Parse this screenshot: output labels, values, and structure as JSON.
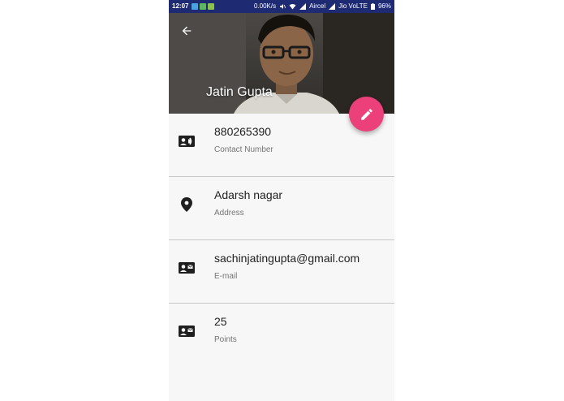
{
  "status_bar": {
    "time": "12:07",
    "speed": "0.00K/s",
    "carrier1": "Aircel",
    "carrier2": "Jio VoLTE",
    "battery": "96%"
  },
  "profile": {
    "name": "Jatin Gupta"
  },
  "colors": {
    "status_bar": "#1e2b73",
    "fab": "#ec407a",
    "background": "#f7f7f7"
  },
  "fields": [
    {
      "value": "880265390",
      "label": "Contact Number",
      "icon": "contact-card-icon"
    },
    {
      "value": "Adarsh nagar",
      "label": "Address",
      "icon": "location-pin-icon"
    },
    {
      "value": "sachinjatingupta@gmail.com",
      "label": "E-mail",
      "icon": "email-card-icon"
    },
    {
      "value": "25",
      "label": "Points",
      "icon": "points-card-icon"
    }
  ]
}
